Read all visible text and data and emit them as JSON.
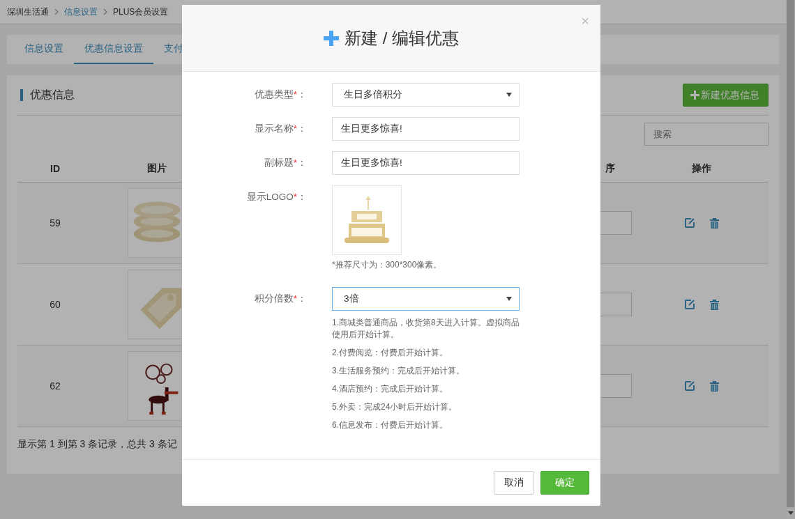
{
  "breadcrumb": [
    {
      "label": "深圳生活通",
      "link": false
    },
    {
      "label": "信息设置",
      "link": true
    },
    {
      "label": "PLUS会员设置",
      "link": false
    }
  ],
  "tabs": [
    {
      "label": "信息设置",
      "selected": false
    },
    {
      "label": "优惠信息设置",
      "selected": true
    },
    {
      "label": "支付",
      "selected": false
    }
  ],
  "panel": {
    "title": "优惠信息",
    "new_button": "新建优惠信息",
    "search": {
      "placeholder": "搜索"
    }
  },
  "table": {
    "columns": [
      "ID",
      "图片",
      "序",
      "操作"
    ],
    "rows": [
      {
        "id": "59"
      },
      {
        "id": "60"
      },
      {
        "id": "62"
      }
    ]
  },
  "records_info": "显示第 1 到第 3 条记录，总共 3 条记",
  "modal": {
    "title": "新建 / 编辑优惠",
    "close": "×",
    "fields": [
      {
        "kind": "select",
        "label": "优惠类型",
        "required_mark": "*",
        "colon": "：",
        "value": "生日多倍积分",
        "focused": false
      },
      {
        "kind": "input",
        "label": "显示名称",
        "required_mark": "*",
        "colon": "：",
        "value": "生日更多惊喜!",
        "focused": false
      },
      {
        "kind": "input",
        "label": "副标题",
        "required_mark": "*",
        "colon": "：",
        "value": "生日更多惊喜!",
        "focused": false
      },
      {
        "label": "显示LOGO",
        "required_mark": "*",
        "colon": "：",
        "hint": "*推荐尺寸为：300*300像素。"
      },
      {
        "kind": "select",
        "label": "积分倍数",
        "required_mark": "*",
        "colon": "：",
        "value": "3倍",
        "focused": true,
        "notes": [
          "1.商城类普通商品，收货第8天进入计算。虚拟商品使用后开始计算。",
          "2.付费阅览：付费后开始计算。",
          "3.生活服务预约：完成后开始计算。",
          "4.酒店预约：完成后开始计算。",
          "5.外卖：完成24小时后开始计算。",
          "6.信息发布：付费后开始计算。"
        ]
      }
    ],
    "buttons": [
      {
        "label": "取消",
        "kind": "default"
      },
      {
        "label": "确定",
        "kind": "primary"
      }
    ]
  }
}
